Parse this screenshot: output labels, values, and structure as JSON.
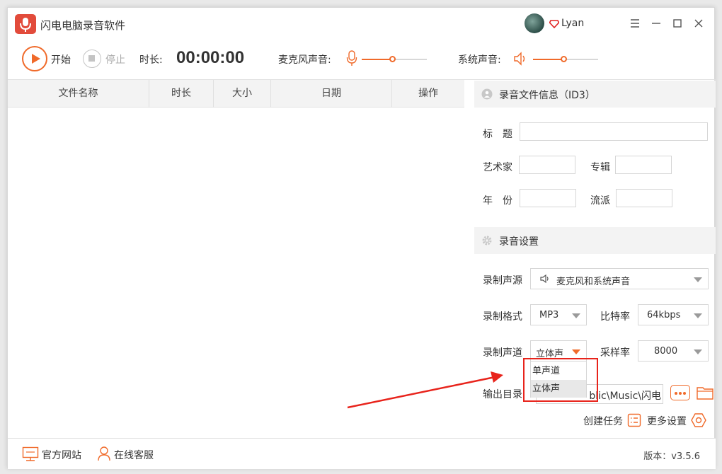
{
  "app": {
    "title": "闪电电脑录音软件",
    "user": "Lyan"
  },
  "toolbar": {
    "start_label": "开始",
    "stop_label": "停止",
    "duration_label": "时长:",
    "timer": "00:00:00",
    "mic_label": "麦克风声音:",
    "system_label": "系统声音:",
    "mic_level": 0.48,
    "system_level": 0.48,
    "accent": "#f06a2a"
  },
  "table": {
    "columns": [
      "文件名称",
      "时长",
      "大小",
      "日期",
      "操作"
    ],
    "rows": []
  },
  "id3": {
    "heading": "录音文件信息（ID3）",
    "title_label": "标　题",
    "artist_label": "艺术家",
    "album_label": "专辑",
    "year_label": "年　份",
    "genre_label": "流派",
    "title": "",
    "artist": "",
    "album": "",
    "year": "",
    "genre": ""
  },
  "settings": {
    "heading": "录音设置",
    "source_label": "录制声源",
    "source_value": "麦克风和系统声音",
    "format_label": "录制格式",
    "format_value": "MP3",
    "bitrate_label": "比特率",
    "bitrate_value": "64kbps",
    "channel_label": "录制声道",
    "channel_value": "立体声",
    "channel_options": [
      "单声道",
      "立体声"
    ],
    "samplerate_label": "采样率",
    "samplerate_value": "8000",
    "output_label": "输出目录",
    "output_path": "blic\\Music\\闪电",
    "create_task": "创建任务",
    "more_settings": "更多设置"
  },
  "footer": {
    "website": "官方网站",
    "support": "在线客服",
    "version": "版本：v3.5.6"
  }
}
